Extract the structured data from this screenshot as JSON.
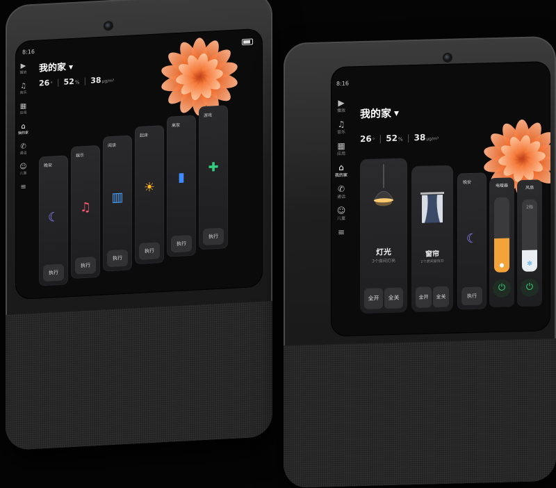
{
  "left_screen": {
    "status_time": "8:16",
    "sidebar": [
      {
        "icon": "play-icon",
        "glyph": "▶",
        "label": "播放",
        "active": false
      },
      {
        "icon": "music-icon",
        "glyph": "♫",
        "label": "音乐",
        "active": false
      },
      {
        "icon": "apps-icon",
        "glyph": "▦",
        "label": "应用",
        "active": false
      },
      {
        "icon": "home-icon",
        "glyph": "⌂",
        "label": "我的家",
        "active": true
      },
      {
        "icon": "phone-icon",
        "glyph": "✆",
        "label": "通话",
        "active": false
      },
      {
        "icon": "child-icon",
        "glyph": "☺",
        "label": "儿童",
        "active": false
      },
      {
        "icon": "layers-icon",
        "glyph": "≡",
        "label": "",
        "active": false
      }
    ],
    "home_title": "我的家",
    "env": {
      "temp": "26",
      "temp_unit": "°",
      "humidity": "52",
      "humidity_unit": "%",
      "pm": "38",
      "pm_unit": "μg/m³"
    },
    "scenes": [
      {
        "name": "晚安",
        "icon": "moon-icon",
        "glyph": "☾",
        "color": "#8f84ff",
        "action": "执行"
      },
      {
        "name": "娱乐",
        "icon": "music-note-icon",
        "glyph": "♫",
        "color": "#ff5a6e",
        "action": "执行"
      },
      {
        "name": "阅读",
        "icon": "book-icon",
        "glyph": "▥",
        "color": "#4aa3ff",
        "action": "执行"
      },
      {
        "name": "起床",
        "icon": "sunrise-icon",
        "glyph": "☀",
        "color": "#ffb627",
        "action": "执行"
      },
      {
        "name": "离家",
        "icon": "door-icon",
        "glyph": "▮",
        "color": "#3d8cff",
        "action": "执行"
      },
      {
        "name": "游戏",
        "icon": "gamepad-icon",
        "glyph": "✚",
        "color": "#35d07f",
        "action": "执行"
      }
    ]
  },
  "right_screen": {
    "status_time": "8:16",
    "sidebar": [
      {
        "icon": "play-icon",
        "glyph": "▶",
        "label": "播放",
        "active": false
      },
      {
        "icon": "music-icon",
        "glyph": "♫",
        "label": "音乐",
        "active": false
      },
      {
        "icon": "apps-icon",
        "glyph": "▦",
        "label": "应用",
        "active": false
      },
      {
        "icon": "home-icon",
        "glyph": "⌂",
        "label": "我的家",
        "active": true
      },
      {
        "icon": "phone-icon",
        "glyph": "✆",
        "label": "通话",
        "active": false
      },
      {
        "icon": "child-icon",
        "glyph": "☺",
        "label": "儿童",
        "active": false
      },
      {
        "icon": "layers-icon",
        "glyph": "≡",
        "label": "",
        "active": false
      }
    ],
    "home_title": "我的家",
    "env": {
      "temp": "26",
      "temp_unit": "°",
      "humidity": "52",
      "humidity_unit": "%",
      "pm": "38",
      "pm_unit": "μg/m³"
    },
    "light_card": {
      "title": "灯光",
      "subtitle": "3个房间灯亮",
      "on": "全开",
      "off": "全关"
    },
    "curtain_card": {
      "title": "窗帘",
      "subtitle": "2个房间窗帘开",
      "on": "全开",
      "off": "全关"
    },
    "scene_card": {
      "name": "晚安",
      "action": "执行"
    },
    "heater": {
      "name": "电暖器",
      "level": 0.45,
      "fill_color": "#f2a33a",
      "icon_glyph": "💧"
    },
    "fan": {
      "name": "风扇",
      "level": 0.3,
      "fill_color": "#e9eef3",
      "tag": "2挡",
      "icon_glyph": "✻"
    }
  }
}
